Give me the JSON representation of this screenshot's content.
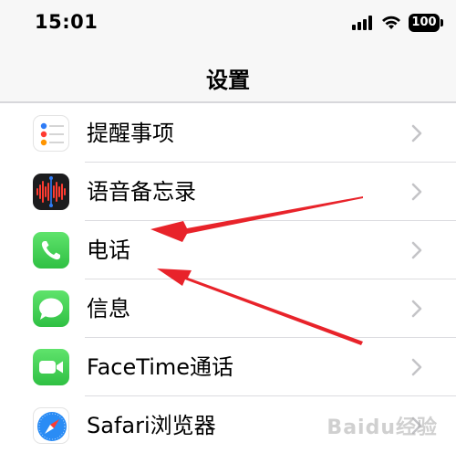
{
  "status_bar": {
    "time": "15:01",
    "battery": "100"
  },
  "nav": {
    "title": "设置"
  },
  "rows": [
    {
      "label": "提醒事项",
      "icon": "reminders-icon"
    },
    {
      "label": "语音备忘录",
      "icon": "voice-memos-icon"
    },
    {
      "label": "电话",
      "icon": "phone-icon"
    },
    {
      "label": "信息",
      "icon": "messages-icon"
    },
    {
      "label": "FaceTime通话",
      "icon": "facetime-icon"
    },
    {
      "label": "Safari浏览器",
      "icon": "safari-icon"
    }
  ],
  "annotations": {
    "arrow_color": "#e8232a"
  },
  "watermark": "Baidu经验"
}
